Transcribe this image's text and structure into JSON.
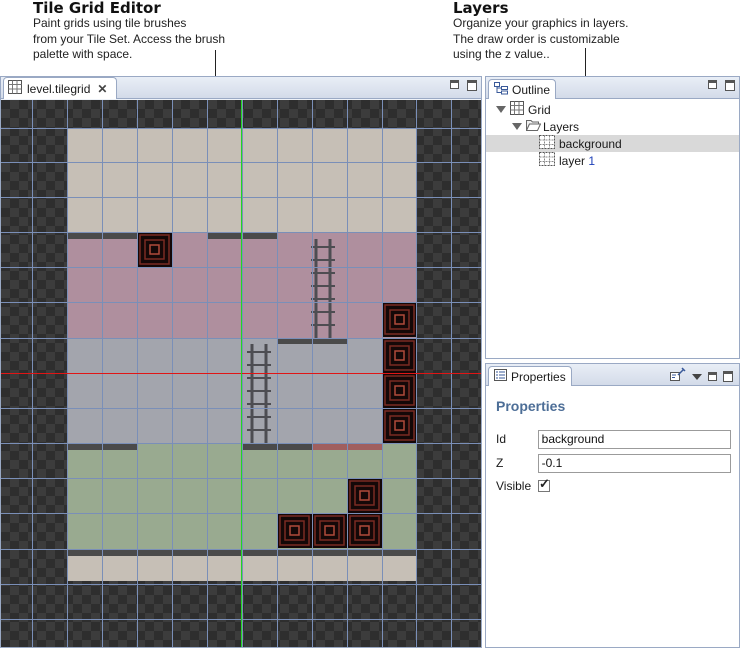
{
  "callouts": {
    "editor": {
      "title": "Tile Grid Editor",
      "lines": [
        "Paint grids using tile brushes",
        "from your Tile Set. Access the brush",
        "palette with space."
      ]
    },
    "layers": {
      "title": "Layers",
      "lines": [
        "Organize your graphics in layers.",
        "The draw order is customizable",
        "using the z value.."
      ]
    }
  },
  "editor": {
    "tab_label": "level.tilegrid",
    "close_glyph": "✕"
  },
  "outline": {
    "tab_label": "Outline",
    "tree": {
      "root": "Grid",
      "layers_folder": "Layers",
      "items": [
        {
          "label": "background",
          "suffix": "",
          "selected": true
        },
        {
          "label": "layer ",
          "suffix": "1",
          "selected": false
        }
      ]
    }
  },
  "properties": {
    "tab_label": "Properties",
    "title": "Properties",
    "id_label": "Id",
    "id_value": "background",
    "z_label": "Z",
    "z_value": "-0.1",
    "visible_label": "Visible",
    "visible_checked": true
  },
  "colors": {
    "sand": "#c6bfb6",
    "mauve": "#af8f9e",
    "slate": "#a3a5ad",
    "sage": "#99aa90",
    "grid_line": "#7a8fb8",
    "axis_x": "#e01515",
    "axis_y": "#22d822",
    "accent_title": "#4d6e97"
  },
  "icons": {
    "editor_tab": "grid-file-icon",
    "outline_tab": "outline-icon",
    "properties_tab": "properties-icon",
    "grid_node": "grid-icon",
    "layers_node": "folder-open-icon",
    "layer_node": "layer-grid-icon"
  }
}
